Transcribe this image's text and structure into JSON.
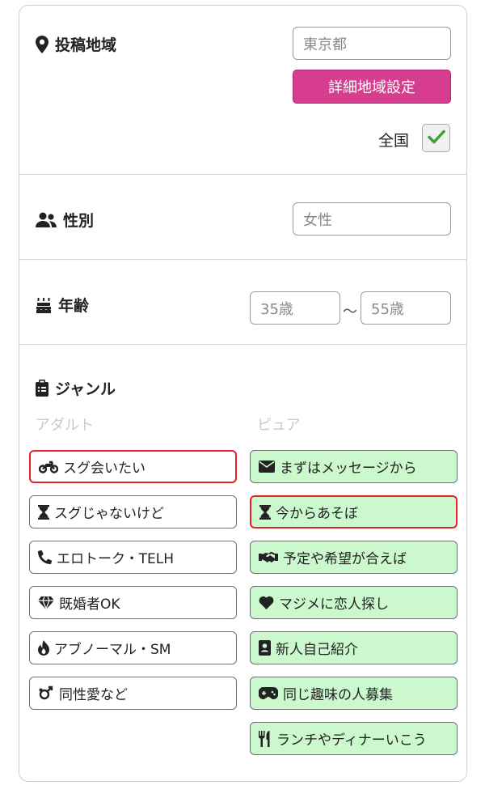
{
  "area": {
    "label": "投稿地域",
    "prefecture_value": "東京都",
    "detail_button": "詳細地域設定",
    "nationwide_label": "全国",
    "nationwide_checked": true
  },
  "sex": {
    "label": "性別",
    "value": "女性"
  },
  "age": {
    "label": "年齢",
    "min": "35歳",
    "separator": "～",
    "max": "55歳"
  },
  "genre": {
    "label": "ジャンル",
    "adult_header": "アダルト",
    "pure_header": "ピュア",
    "adult": [
      {
        "label": "スグ会いたい",
        "icon": "motorcycle-icon",
        "selected": true
      },
      {
        "label": "スグじゃないけど",
        "icon": "hourglass-icon",
        "selected": false
      },
      {
        "label": "エロトーク・TELH",
        "icon": "phone-icon",
        "selected": false
      },
      {
        "label": "既婚者OK",
        "icon": "diamond-icon",
        "selected": false
      },
      {
        "label": "アブノーマル・SM",
        "icon": "fire-icon",
        "selected": false
      },
      {
        "label": "同性愛など",
        "icon": "gender-icon",
        "selected": false
      }
    ],
    "pure": [
      {
        "label": "まずはメッセージから",
        "icon": "envelope-icon",
        "selected": false
      },
      {
        "label": "今からあそぼ",
        "icon": "hourglass-icon",
        "selected": true
      },
      {
        "label": "予定や希望が合えば",
        "icon": "handshake-icon",
        "selected": false
      },
      {
        "label": "マジメに恋人探し",
        "icon": "heart-icon",
        "selected": false
      },
      {
        "label": "新人自己紹介",
        "icon": "id-card-icon",
        "selected": false
      },
      {
        "label": "同じ趣味の人募集",
        "icon": "gamepad-icon",
        "selected": false
      },
      {
        "label": "ランチやディナーいこう",
        "icon": "utensils-icon",
        "selected": false
      }
    ]
  },
  "colors": {
    "accent_button": "#d63d8f",
    "pure_tag_bg": "#cbf9cd",
    "selected_border": "#e8202a",
    "check_green": "#3aa535"
  }
}
